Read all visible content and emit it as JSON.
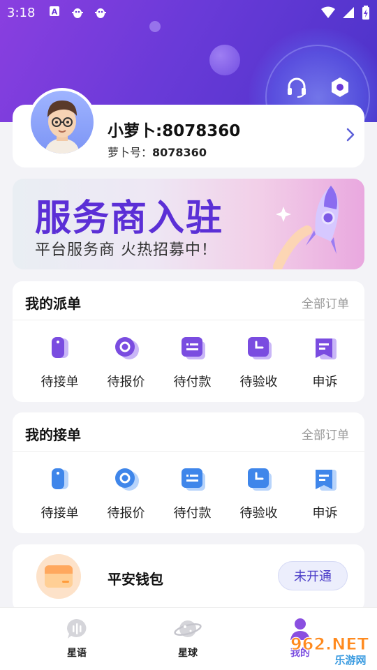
{
  "status_bar": {
    "time": "3:18",
    "notif_icons": [
      "a-icon",
      "bug-icon",
      "bug-icon"
    ],
    "right_icons": [
      "wifi-icon",
      "signal-icon",
      "battery-icon"
    ]
  },
  "header": {
    "icons": [
      "headset-icon",
      "hex-settings-icon"
    ]
  },
  "profile": {
    "name": "小萝卜:8078360",
    "id_label": "萝卜号：",
    "id_value": "8078360"
  },
  "banner": {
    "title": "服务商入驻",
    "subtitle": "平台服务商 火热招募中！"
  },
  "dispatch": {
    "title": "我的派单",
    "all_label": "全部订单",
    "items": [
      {
        "label": "待接单",
        "icon": "pending-accept-icon"
      },
      {
        "label": "待报价",
        "icon": "pending-quote-icon"
      },
      {
        "label": "待付款",
        "icon": "pending-payment-icon"
      },
      {
        "label": "待验收",
        "icon": "pending-acceptance-icon"
      },
      {
        "label": "申诉",
        "icon": "appeal-icon"
      }
    ]
  },
  "receive": {
    "title": "我的接单",
    "all_label": "全部订单",
    "items": [
      {
        "label": "待接单",
        "icon": "pending-accept-icon"
      },
      {
        "label": "待报价",
        "icon": "pending-quote-icon"
      },
      {
        "label": "待付款",
        "icon": "pending-payment-icon"
      },
      {
        "label": "待验收",
        "icon": "pending-acceptance-icon"
      },
      {
        "label": "申诉",
        "icon": "appeal-icon"
      }
    ]
  },
  "wallet": {
    "name": "平安钱包",
    "button": "未开通"
  },
  "bottom_nav": [
    {
      "label": "星语",
      "icon": "chat-bubble-icon"
    },
    {
      "label": "星球",
      "icon": "planet-icon"
    },
    {
      "label": "我的",
      "icon": "user-icon"
    }
  ],
  "watermark": {
    "brand": "962.NET",
    "sub": "乐游网"
  },
  "colors": {
    "primary": "#6a3ad8",
    "dispatch_icon": "#7a4ce0",
    "receive_icon": "#3f86ea"
  }
}
